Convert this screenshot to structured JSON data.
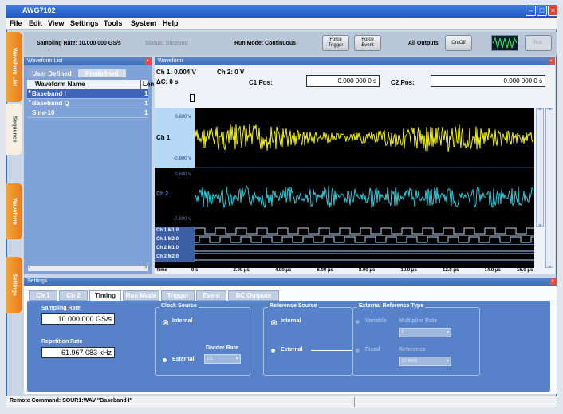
{
  "window": {
    "title": "AWG7102",
    "controls": [
      "minimize-icon",
      "maximize-icon",
      "close-icon"
    ]
  },
  "menu": [
    "File",
    "Edit",
    "View",
    "Settings",
    "Tools",
    "System",
    "Help"
  ],
  "toolbar": {
    "sampling_rate": "Sampling Rate: 10.000 000 GS/s",
    "status": "Status: Stopped",
    "run_mode": "Run Mode: Continuous",
    "force_trigger": "Force Trigger",
    "force_event": "Force Event",
    "all_outputs": "All Outputs",
    "onoff": "On/Off",
    "run": "Run"
  },
  "side_tabs": [
    "Waveform List",
    "Sequence",
    "Waveform",
    "Settings"
  ],
  "waveform_list": {
    "header": "Waveform List",
    "tabs": [
      "User Defined",
      "Predefined"
    ],
    "columns": [
      "Waveform Name",
      "Len"
    ],
    "rows": [
      {
        "name": "Baseband I",
        "len": "1"
      },
      {
        "name": "Baseband Q",
        "len": "1"
      },
      {
        "name": "Sine-10",
        "len": "1"
      }
    ]
  },
  "waveform": {
    "header": "Waveform",
    "ch1_value": "Ch 1: 0.004 V",
    "ch2_value": "Ch 2: 0 V",
    "delta_c": "ΔC: 0 s",
    "c1_pos_label": "C1 Pos:",
    "c1_pos_value": "0.000 000 0 s",
    "c2_pos_label": "C2 Pos:",
    "c2_pos_value": "0.000 000 0 s",
    "ch1": {
      "label": "Ch 1",
      "top": "0.600 V",
      "bottom": "-0.600 V"
    },
    "ch2": {
      "label": "Ch 2",
      "top": "0.600 V",
      "bottom": "-0.600 V"
    },
    "markers": [
      "Ch 1 M1 0",
      "Ch 1 M2 0",
      "Ch 2 M1 0",
      "Ch 2 M2 0"
    ],
    "time_axis": {
      "label": "Time",
      "ticks": [
        "0 s",
        "2.00 μs",
        "4.00 μs",
        "6.00 μs",
        "8.00 μs",
        "10.0 μs",
        "12.0 μs",
        "14.0 μs",
        "16.0 μs"
      ]
    },
    "colors": {
      "ch1": "#f2ef22",
      "ch2": "#35c6d8",
      "marker": "#b6d9f8"
    }
  },
  "settings": {
    "header": "Settings",
    "tabs": [
      "Ch 1",
      "Ch 2",
      "Timing",
      "Run Mode",
      "Trigger",
      "Event",
      "DC Outputs"
    ],
    "selected_tab": "Timing",
    "sampling_rate_label": "Sampling Rate",
    "sampling_rate_value": "10.000 000 GS/s",
    "repetition_rate_label": "Repetition Rate",
    "repetition_rate_value": "61.967 083 kHz",
    "clock_source": {
      "label": "Clock Source",
      "internal": "Internal",
      "external": "External",
      "divider_label": "Divider Rate",
      "divider_value": "1/1"
    },
    "reference_source": {
      "label": "Reference Source",
      "internal": "Internal",
      "external": "External"
    },
    "ext_ref_type": {
      "label": "External Reference Type",
      "variable": "Variable",
      "multiplier_label": "Multiplier Rate",
      "multiplier_value": "1",
      "fixed": "Fixed",
      "reference_label": "Reference",
      "reference_value": "10 MHz"
    }
  },
  "status_bar": {
    "remote_command": "Remote Command: SOUR1:WAV \"Baseband I\""
  }
}
